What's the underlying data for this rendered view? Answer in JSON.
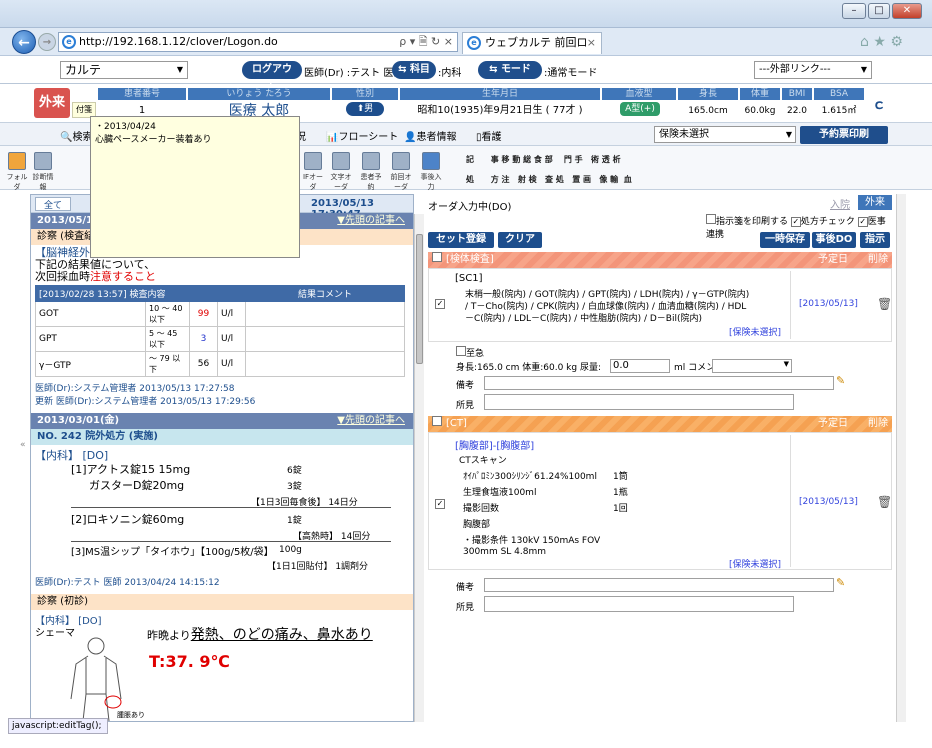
{
  "browser": {
    "url": "http://192.168.1.12/clover/Logon.do",
    "url_icons": "ρ ▾ 🗎 ↻ ×",
    "tab_title": "ウェブカルテ 前回ログ...",
    "tab_close": "×",
    "nav_icons": "⌂ ★ ⚙"
  },
  "header": {
    "app_select": "カルテ",
    "logout": "ログアウト",
    "role_text": "医師(Dr) :テスト 医師",
    "dept_pill": "科目",
    "dept_text": ":内科",
    "mode_pill": "モード",
    "mode_text": ":通常モード",
    "external_link": "---外部リンク---"
  },
  "patient": {
    "outpatient_badge": "外来",
    "insurance": "付箋",
    "labels": {
      "id": "患者番号",
      "kana": "いりょう たろう",
      "sex": "性別",
      "birth": "生年月日",
      "blood": "血液型",
      "height": "身長",
      "weight": "体重",
      "bmi": "BMI",
      "bsa": "BSA"
    },
    "id": "1",
    "name": "医療 太郎",
    "sex": "男",
    "birth": "昭和10(1935)年9月21日生 ( 77才 )",
    "blood": "A型(+)",
    "height": "165.0cm",
    "weight": "60.0kg",
    "bmi": "22.0",
    "bsa": "1.615㎡"
  },
  "nav": {
    "search": "検索",
    "status": "状況",
    "flowsheet": "フローシート",
    "patient_info": "患者情報",
    "nursing": "看護",
    "insurance_select": "保険未選択",
    "reserve_print": "予約票印刷"
  },
  "toolbar": {
    "icons": [
      "フォルダ",
      "診断情報"
    ],
    "right_icons": [
      "IFオーダ",
      "文字オーダ",
      "患者予約",
      "前回オーダ",
      "事後入力"
    ],
    "grid_row1": [
      "記",
      "事",
      "移",
      "動",
      "総",
      "食",
      "部",
      "門",
      "手",
      "術",
      "透",
      "析"
    ],
    "grid_row2": [
      "処",
      "方",
      "注",
      "射",
      "検",
      "査",
      "処",
      "置",
      "画",
      "像",
      "輸",
      "血"
    ]
  },
  "tooltip": {
    "date": "・2013/04/24",
    "text": "心臓ペースメーカー装着あり"
  },
  "left": {
    "tab_all": "全て",
    "timestamp": "2013/05/13 17:30:47",
    "date1": "2013/05/1",
    "prev_link": "▼先頭の記事へ",
    "sect1": "診察 (検査結",
    "dept_line": "【脳神経外科】 [DO]",
    "notice1": "下記の結果値について、",
    "notice2": "次回採血時",
    "notice3": "注意すること",
    "lab_header": "[2013/02/28 13:57] 検査内容",
    "lab_comment": "結果コメント",
    "lab_rows": [
      {
        "name": "GOT",
        "range": "10 〜 40 以下",
        "value": "99",
        "unit": "U/l"
      },
      {
        "name": "GPT",
        "range": "5 〜 45 以下",
        "value": "3",
        "unit": "U/l"
      },
      {
        "name": "γ－GTP",
        "range": "〜 79 以下",
        "value": "56",
        "unit": "U/l"
      }
    ],
    "doc1": "医師(Dr):システム管理者 2013/05/13 17:27:58",
    "doc2": "更新 医師(Dr):システム管理者 2013/05/13 17:29:56",
    "date2": "2013/03/01(金)",
    "rx_no": "NO. 242 院外処方 (実施)",
    "rx_dept": "【内科】 [DO]",
    "rx1_name": "[1]アクトス錠15 15mg",
    "rx1_qty": "6錠",
    "rx1b_name": "ガスターD錠20mg",
    "rx1b_qty": "3錠",
    "rx1_sig": "【1日3回毎食後】 14日分",
    "rx2_name": "[2]ロキソニン錠60mg",
    "rx2_qty": "1錠",
    "rx2_sig": "【高熱時】 14回分",
    "rx3_name": "[3]MS温シップ「タイホウ」【100g/5枚/袋】",
    "rx3_qty": "100g",
    "rx3_sig": "【1日1回貼付】 1調剤分",
    "doc3": "医師(Dr):テスト 医師 2013/04/24 14:15:12",
    "sect2": "診察 (初診)",
    "exam_dept": "【内科】 [DO]",
    "schema": "シェーマ",
    "symptom_prefix": "昨晩より",
    "symptom": "発熱、のどの痛み、鼻水あり",
    "temp": "T:37. 9℃",
    "figure_note": "腫脹あり"
  },
  "right": {
    "status": "オーダ入力中(DO)",
    "inpatient": "入院",
    "outpatient": "外来",
    "chk_print": "指示箋を印刷する",
    "chk_rx": "処方チェック",
    "chk_link": "医事連携",
    "set_register": "セット登録",
    "clear": "クリア",
    "temp_save": "一時保存",
    "after_do": "事後DO",
    "instruct": "指示",
    "order1_title": "[検体検査]",
    "sched_label": "予定日",
    "delete_label": "削除",
    "sc1": "[SC1]",
    "sc1_items1": "末梢一般(院内) / GOT(院内) / GPT(院内) / LDH(院内) / γ－GTP(院内)",
    "sc1_items2": "/ T－Cho(院内) / CPK(院内) / 白血球像(院内) / 血清血糖(院内) / HDL",
    "sc1_items3": "－C(院内) / LDL－C(院内) / 中性脂肪(院内) / D－Bil(院内)",
    "ins_unselected": "[保険未選択]",
    "date1": "[2013/05/13]",
    "urgent": "至急",
    "hw_line": "身長:165.0 cm 体重:60.0 kg 尿量:",
    "urine": "0.0",
    "ml_comment": "ml コメント:",
    "biko": "備考",
    "shoken": "所見",
    "order2_title": "[CT]",
    "ct_region": "[胸腹部]-[胸腹部]",
    "ct_scan": "CTスキャン",
    "ct_items": [
      {
        "name": "ｵｲﾊﾟﾛﾐﾝ300ｼﾘﾝｼﾞ61.24%100ml",
        "qty": "1筒"
      },
      {
        "name": "生理食塩液100ml",
        "qty": "1瓶"
      },
      {
        "name": "撮影回数",
        "qty": "1回"
      }
    ],
    "ct_site": "胸腹部",
    "ct_cond1": "・撮影条件 130kV 150mAs FOV",
    "ct_cond2": "300mm SL 4.8mm",
    "date2": "[2013/05/13]"
  },
  "statusbar": "javascript:editTag();",
  "colors": {
    "accent": "#1d4e8d",
    "date_bar": "#6a83b0",
    "outpatient_red": "#d9534f",
    "warning_red": "#e00000"
  }
}
